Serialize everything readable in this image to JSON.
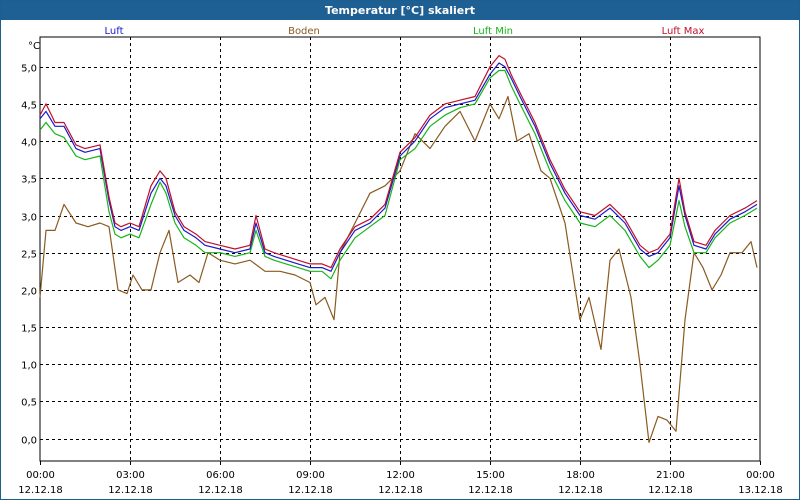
{
  "window": {
    "title": "Temperatur [°C] skaliert"
  },
  "chart_data": {
    "type": "line",
    "unit": "°C",
    "title": "Temperatur [°C] skaliert",
    "ylim": [
      -0.3,
      5.4
    ],
    "xlim": [
      0,
      24
    ],
    "grid": true,
    "legend_placement": "top",
    "y_ticks": [
      {
        "v": 0.0,
        "label": "0,0"
      },
      {
        "v": 0.5,
        "label": "0,5"
      },
      {
        "v": 1.0,
        "label": "1,0"
      },
      {
        "v": 1.5,
        "label": "1,5"
      },
      {
        "v": 2.0,
        "label": "2,0"
      },
      {
        "v": 2.5,
        "label": "2,5"
      },
      {
        "v": 3.0,
        "label": "3,0"
      },
      {
        "v": 3.5,
        "label": "3,5"
      },
      {
        "v": 4.0,
        "label": "4,0"
      },
      {
        "v": 4.5,
        "label": "4,5"
      },
      {
        "v": 5.0,
        "label": "5,0"
      }
    ],
    "x_ticks": [
      {
        "v": 0,
        "time": "00:00",
        "date": "12.12.18"
      },
      {
        "v": 3,
        "time": "03:00",
        "date": "12.12.18"
      },
      {
        "v": 6,
        "time": "06:00",
        "date": "12.12.18"
      },
      {
        "v": 9,
        "time": "09:00",
        "date": "12.12.18"
      },
      {
        "v": 12,
        "time": "12:00",
        "date": "12.12.18"
      },
      {
        "v": 15,
        "time": "15:00",
        "date": "12.12.18"
      },
      {
        "v": 18,
        "time": "18:00",
        "date": "12.12.18"
      },
      {
        "v": 21,
        "time": "21:00",
        "date": "12.12.18"
      },
      {
        "v": 24,
        "time": "00:00",
        "date": "13.12.18"
      }
    ],
    "series": [
      {
        "name": "Luft",
        "color": "#1a1acc",
        "x": [
          0,
          0.2,
          0.5,
          0.8,
          1.2,
          1.5,
          2.0,
          2.3,
          2.5,
          2.7,
          3.0,
          3.3,
          3.7,
          4.0,
          4.2,
          4.5,
          4.8,
          5.2,
          5.5,
          6.0,
          6.5,
          7.0,
          7.2,
          7.5,
          7.8,
          8.2,
          8.6,
          9.0,
          9.4,
          9.7,
          10.0,
          10.5,
          11.0,
          11.5,
          12.0,
          12.5,
          13.0,
          13.5,
          14.0,
          14.5,
          15.0,
          15.3,
          15.5,
          15.7,
          16.0,
          16.5,
          17.0,
          17.5,
          18.0,
          18.5,
          19.0,
          19.5,
          20.0,
          20.3,
          20.6,
          21.0,
          21.3,
          21.5,
          21.8,
          22.2,
          22.5,
          23.0,
          23.5,
          23.9
        ],
        "y": [
          4.3,
          4.4,
          4.2,
          4.2,
          3.9,
          3.85,
          3.9,
          3.2,
          2.85,
          2.8,
          2.85,
          2.8,
          3.3,
          3.5,
          3.4,
          3.0,
          2.8,
          2.7,
          2.6,
          2.55,
          2.5,
          2.55,
          2.9,
          2.5,
          2.45,
          2.4,
          2.35,
          2.3,
          2.3,
          2.25,
          2.5,
          2.8,
          2.9,
          3.1,
          3.8,
          4.0,
          4.3,
          4.45,
          4.5,
          4.55,
          4.9,
          5.05,
          5.0,
          4.85,
          4.6,
          4.2,
          3.7,
          3.3,
          3.0,
          2.95,
          3.1,
          2.9,
          2.55,
          2.45,
          2.5,
          2.7,
          3.4,
          3.0,
          2.6,
          2.55,
          2.75,
          2.95,
          3.05,
          3.15
        ]
      },
      {
        "name": "Boden",
        "color": "#8a5a22",
        "x": [
          0,
          0.2,
          0.5,
          0.8,
          1.2,
          1.6,
          2.0,
          2.3,
          2.6,
          2.9,
          3.1,
          3.4,
          3.7,
          4.0,
          4.3,
          4.6,
          5.0,
          5.3,
          5.6,
          6.0,
          6.5,
          7.0,
          7.5,
          8.0,
          8.5,
          9.0,
          9.2,
          9.5,
          9.8,
          10.0,
          10.5,
          11.0,
          11.5,
          12.0,
          12.5,
          13.0,
          13.5,
          14.0,
          14.5,
          15.0,
          15.3,
          15.6,
          15.9,
          16.3,
          16.7,
          17.0,
          17.5,
          18.0,
          18.3,
          18.7,
          19.0,
          19.3,
          19.7,
          20.0,
          20.3,
          20.6,
          20.9,
          21.2,
          21.5,
          21.8,
          22.1,
          22.4,
          22.7,
          23.0,
          23.4,
          23.7,
          23.9
        ],
        "y": [
          1.9,
          2.8,
          2.8,
          3.15,
          2.9,
          2.85,
          2.9,
          2.85,
          2.0,
          1.95,
          2.2,
          2.0,
          2.0,
          2.5,
          2.8,
          2.1,
          2.2,
          2.1,
          2.5,
          2.4,
          2.35,
          2.4,
          2.25,
          2.25,
          2.2,
          2.1,
          1.8,
          1.9,
          1.6,
          2.5,
          2.9,
          3.3,
          3.4,
          3.6,
          4.1,
          3.9,
          4.2,
          4.4,
          4.0,
          4.5,
          4.3,
          4.6,
          4.0,
          4.1,
          3.6,
          3.5,
          2.9,
          1.6,
          1.9,
          1.2,
          2.4,
          2.55,
          1.9,
          1.0,
          -0.05,
          0.3,
          0.25,
          0.1,
          1.6,
          2.5,
          2.3,
          2.0,
          2.2,
          2.5,
          2.5,
          2.65,
          2.3
        ]
      },
      {
        "name": "Luft Min",
        "color": "#18b418",
        "x": [
          0,
          0.2,
          0.5,
          0.8,
          1.2,
          1.5,
          2.0,
          2.3,
          2.5,
          2.7,
          3.0,
          3.3,
          3.7,
          4.0,
          4.2,
          4.5,
          4.8,
          5.2,
          5.5,
          6.0,
          6.5,
          7.0,
          7.2,
          7.5,
          7.8,
          8.2,
          8.6,
          9.0,
          9.4,
          9.7,
          10.0,
          10.5,
          11.0,
          11.5,
          12.0,
          12.5,
          13.0,
          13.5,
          14.0,
          14.5,
          15.0,
          15.3,
          15.5,
          15.7,
          16.0,
          16.5,
          17.0,
          17.5,
          18.0,
          18.5,
          19.0,
          19.5,
          20.0,
          20.3,
          20.6,
          21.0,
          21.3,
          21.5,
          21.8,
          22.2,
          22.5,
          23.0,
          23.5,
          23.9
        ],
        "y": [
          4.15,
          4.25,
          4.1,
          4.05,
          3.8,
          3.75,
          3.8,
          3.05,
          2.75,
          2.7,
          2.75,
          2.7,
          3.15,
          3.45,
          3.3,
          2.9,
          2.7,
          2.6,
          2.5,
          2.5,
          2.45,
          2.5,
          2.8,
          2.45,
          2.4,
          2.35,
          2.3,
          2.25,
          2.25,
          2.15,
          2.4,
          2.7,
          2.85,
          3.0,
          3.75,
          3.9,
          4.2,
          4.35,
          4.45,
          4.5,
          4.85,
          4.95,
          4.95,
          4.75,
          4.5,
          4.1,
          3.6,
          3.2,
          2.9,
          2.85,
          3.0,
          2.8,
          2.45,
          2.3,
          2.4,
          2.6,
          3.2,
          2.85,
          2.5,
          2.5,
          2.7,
          2.9,
          3.0,
          3.1
        ]
      },
      {
        "name": "Luft Max",
        "color": "#c0102a",
        "x": [
          0,
          0.2,
          0.5,
          0.8,
          1.2,
          1.5,
          2.0,
          2.3,
          2.5,
          2.7,
          3.0,
          3.3,
          3.7,
          4.0,
          4.2,
          4.5,
          4.8,
          5.2,
          5.5,
          6.0,
          6.5,
          7.0,
          7.2,
          7.5,
          7.8,
          8.2,
          8.6,
          9.0,
          9.4,
          9.7,
          10.0,
          10.5,
          11.0,
          11.5,
          12.0,
          12.5,
          13.0,
          13.5,
          14.0,
          14.5,
          15.0,
          15.3,
          15.5,
          15.7,
          16.0,
          16.5,
          17.0,
          17.5,
          18.0,
          18.5,
          19.0,
          19.5,
          20.0,
          20.3,
          20.6,
          21.0,
          21.3,
          21.5,
          21.8,
          22.2,
          22.5,
          23.0,
          23.5,
          23.9
        ],
        "y": [
          4.35,
          4.5,
          4.25,
          4.25,
          3.95,
          3.9,
          3.95,
          3.25,
          2.9,
          2.85,
          2.9,
          2.85,
          3.4,
          3.6,
          3.5,
          3.05,
          2.85,
          2.75,
          2.65,
          2.6,
          2.55,
          2.6,
          3.0,
          2.55,
          2.5,
          2.45,
          2.4,
          2.35,
          2.35,
          2.3,
          2.55,
          2.85,
          2.95,
          3.15,
          3.85,
          4.05,
          4.35,
          4.5,
          4.55,
          4.6,
          5.0,
          5.15,
          5.1,
          4.9,
          4.65,
          4.25,
          3.75,
          3.35,
          3.05,
          3.0,
          3.15,
          2.95,
          2.6,
          2.5,
          2.55,
          2.75,
          3.5,
          3.05,
          2.65,
          2.6,
          2.8,
          3.0,
          3.1,
          3.2
        ]
      }
    ]
  }
}
